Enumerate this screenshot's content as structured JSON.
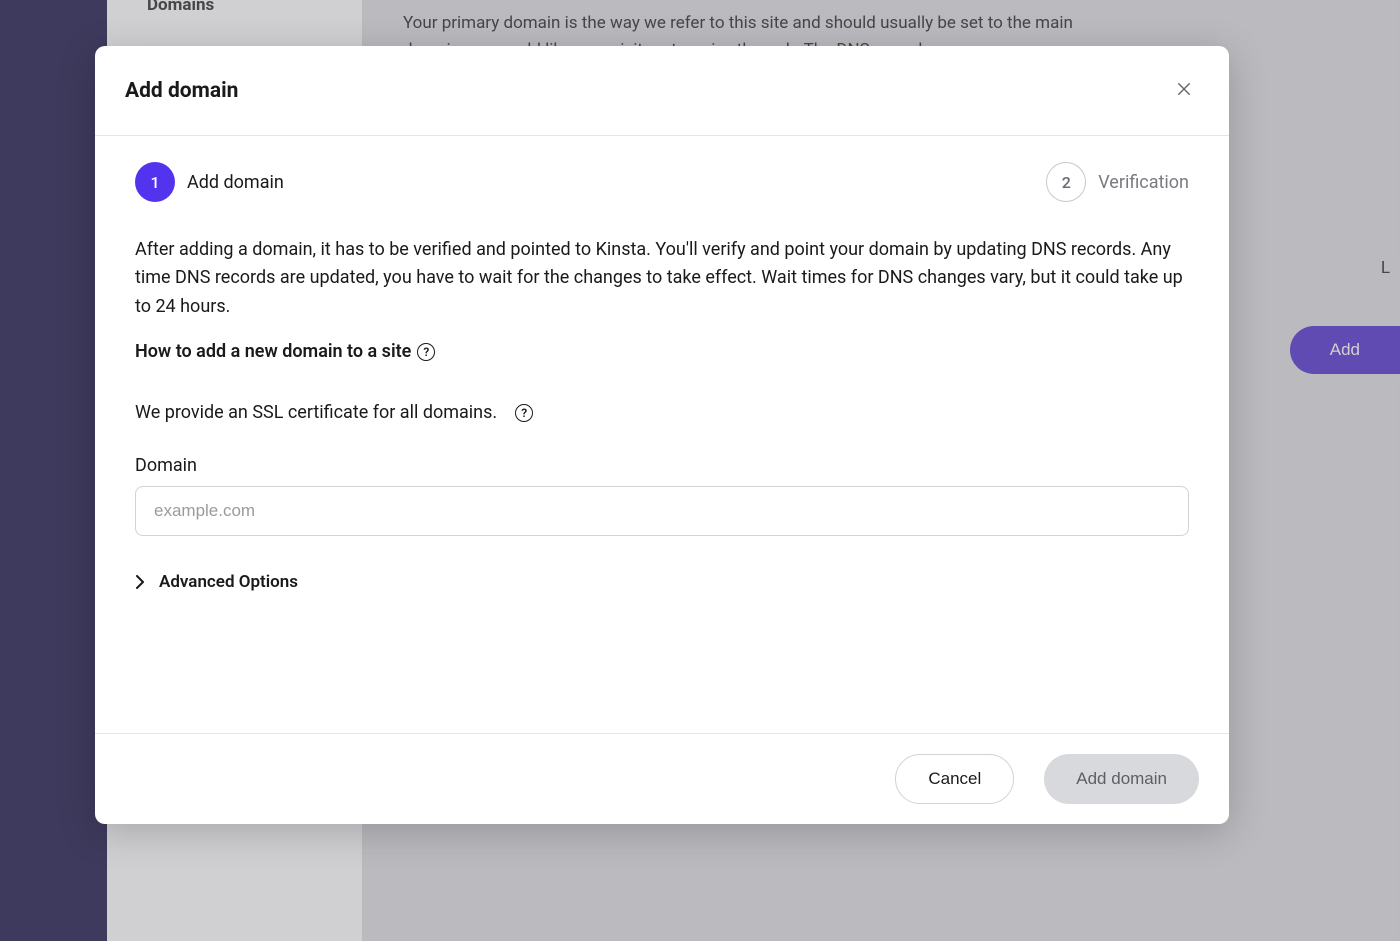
{
  "background": {
    "nav_item": "Domains",
    "content_text": "Your primary domain is the way we refer to this site and should usually be set to the main domain you would like your visitors to arrive through. The DNS records",
    "right_label": "L",
    "add_button": "Add"
  },
  "modal": {
    "title": "Add domain",
    "stepper": {
      "step1": {
        "number": "1",
        "label": "Add domain"
      },
      "step2": {
        "number": "2",
        "label": "Verification"
      }
    },
    "description": "After adding a domain, it has to be verified and pointed to Kinsta. You'll verify and point your domain by updating DNS records. Any time DNS records are updated, you have to wait for the changes to take effect. Wait times for DNS changes vary, but it could take up to 24 hours.",
    "help_link": "How to add a new domain to a site",
    "ssl_text": "We provide an SSL certificate for all domains.",
    "domain_label": "Domain",
    "domain_placeholder": "example.com",
    "advanced_label": "Advanced Options",
    "footer": {
      "cancel": "Cancel",
      "submit": "Add domain"
    }
  }
}
